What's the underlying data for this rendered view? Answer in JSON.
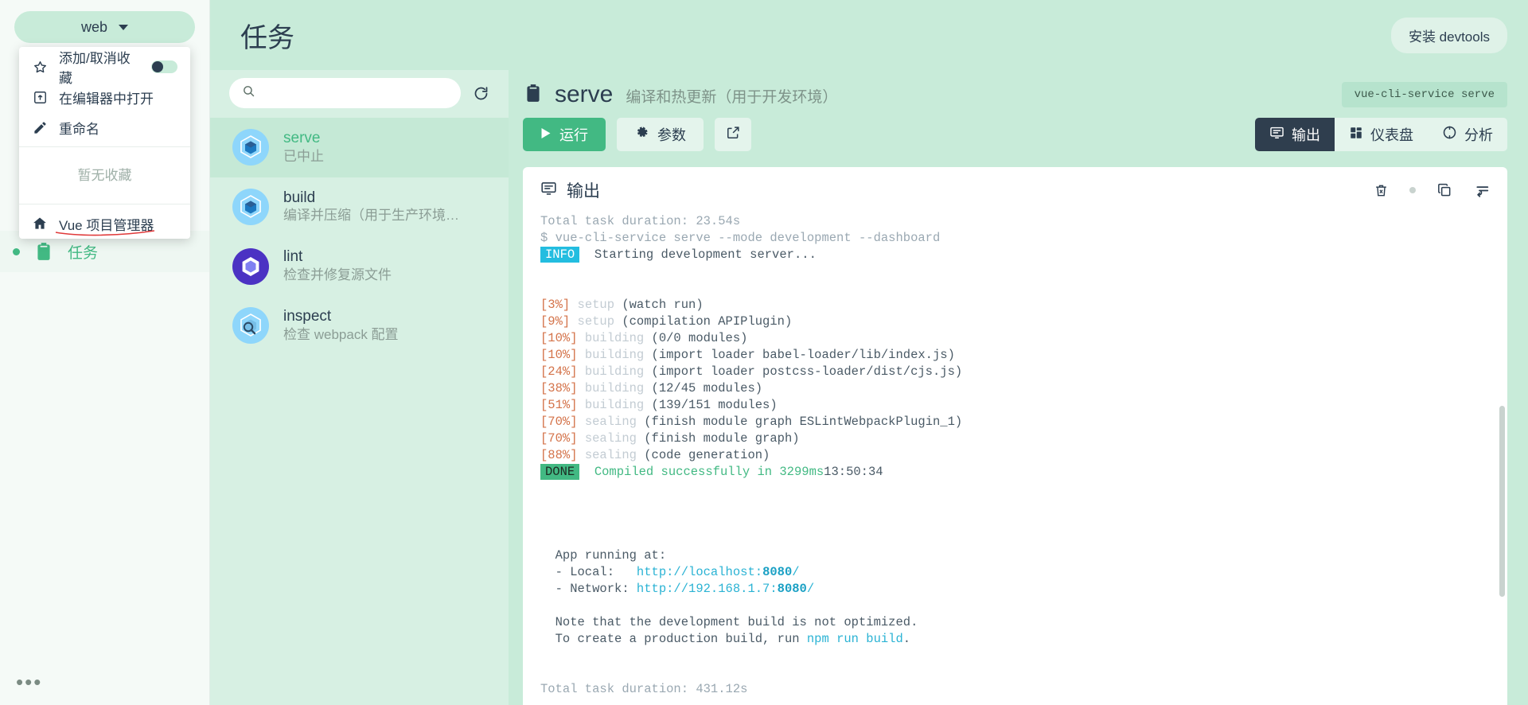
{
  "sidebar": {
    "project_switcher": {
      "label": "web",
      "icon": "chevron-down-icon"
    },
    "nav_items": [
      {
        "label": "",
        "icon": "dashboard-icon"
      },
      {
        "label": "",
        "icon": "plugins-icon"
      },
      {
        "label": "",
        "icon": "dependencies-icon"
      },
      {
        "label": "",
        "icon": "configuration-icon"
      },
      {
        "label": "任务",
        "icon": "tasks-icon",
        "active": true
      }
    ],
    "more_label": "•••",
    "dropdown": {
      "items": [
        {
          "label": "添加/取消收藏",
          "icon": "star-icon",
          "toggle": true
        },
        {
          "label": "在编辑器中打开",
          "icon": "open-in-editor-icon"
        },
        {
          "label": "重命名",
          "icon": "pencil-icon"
        }
      ],
      "empty_text": "暂无收藏",
      "home_item": {
        "label": "Vue 项目管理器",
        "icon": "home-icon"
      }
    }
  },
  "header": {
    "title": "任务",
    "devtools_button": "安装 devtools"
  },
  "tasklist": {
    "search": {
      "value": "",
      "placeholder": "",
      "icon": "search-icon"
    },
    "refresh_icon": "refresh-icon",
    "items": [
      {
        "name": "serve",
        "desc": "已中止",
        "icon": "webpack-icon",
        "selected": true
      },
      {
        "name": "build",
        "desc": "编译并压缩（用于生产环境…",
        "icon": "webpack-icon",
        "selected": false
      },
      {
        "name": "lint",
        "desc": "检查并修复源文件",
        "icon": "eslint-icon",
        "selected": false
      },
      {
        "name": "inspect",
        "desc": "检查 webpack 配置",
        "icon": "inspect-icon",
        "selected": false
      }
    ]
  },
  "detail": {
    "icon": "clipboard-icon",
    "name": "serve",
    "desc": "编译和热更新（用于开发环境）",
    "command_chip": "vue-cli-service serve",
    "buttons": {
      "run": {
        "label": "运行",
        "icon": "play-icon"
      },
      "params": {
        "label": "参数",
        "icon": "gear-icon"
      },
      "open_external": {
        "label": "",
        "icon": "external-link-icon"
      }
    },
    "tabs": [
      {
        "label": "输出",
        "icon": "terminal-icon",
        "active": true
      },
      {
        "label": "仪表盘",
        "icon": "dashboard-grid-icon",
        "active": false
      },
      {
        "label": "分析",
        "icon": "analyze-icon",
        "active": false
      }
    ]
  },
  "output": {
    "title": "输出",
    "title_icon": "terminal-icon",
    "actions": [
      {
        "icon": "trash-icon"
      },
      {
        "icon": "status-dot-icon"
      },
      {
        "icon": "copy-icon"
      },
      {
        "icon": "wrap-lines-icon"
      }
    ],
    "lines": [
      {
        "segs": [
          {
            "t": "Total task duration: 23.54s",
            "c": "muted"
          }
        ]
      },
      {
        "segs": [
          {
            "t": "$ vue-cli-service serve --mode development --dashboard",
            "c": "muted"
          }
        ]
      },
      {
        "segs": [
          {
            "t": "INFO",
            "c": "badge-info"
          },
          {
            "t": "  Starting development server...",
            "c": ""
          }
        ]
      },
      {
        "segs": [
          {
            "t": "",
            "c": ""
          }
        ]
      },
      {
        "segs": [
          {
            "t": "",
            "c": ""
          }
        ]
      },
      {
        "segs": [
          {
            "t": "[3%] ",
            "c": "pct"
          },
          {
            "t": "setup ",
            "c": "dim"
          },
          {
            "t": "(watch run)",
            "c": ""
          }
        ]
      },
      {
        "segs": [
          {
            "t": "[9%] ",
            "c": "pct"
          },
          {
            "t": "setup ",
            "c": "dim"
          },
          {
            "t": "(compilation APIPlugin)",
            "c": ""
          }
        ]
      },
      {
        "segs": [
          {
            "t": "[10%] ",
            "c": "pct"
          },
          {
            "t": "building ",
            "c": "dim"
          },
          {
            "t": "(0/0 modules)",
            "c": ""
          }
        ]
      },
      {
        "segs": [
          {
            "t": "[10%] ",
            "c": "pct"
          },
          {
            "t": "building ",
            "c": "dim"
          },
          {
            "t": "(import loader babel-loader/lib/index.js)",
            "c": ""
          }
        ]
      },
      {
        "segs": [
          {
            "t": "[24%] ",
            "c": "pct"
          },
          {
            "t": "building ",
            "c": "dim"
          },
          {
            "t": "(import loader postcss-loader/dist/cjs.js)",
            "c": ""
          }
        ]
      },
      {
        "segs": [
          {
            "t": "[38%] ",
            "c": "pct"
          },
          {
            "t": "building ",
            "c": "dim"
          },
          {
            "t": "(12/45 modules)",
            "c": ""
          }
        ]
      },
      {
        "segs": [
          {
            "t": "[51%] ",
            "c": "pct"
          },
          {
            "t": "building ",
            "c": "dim"
          },
          {
            "t": "(139/151 modules)",
            "c": ""
          }
        ]
      },
      {
        "segs": [
          {
            "t": "[70%] ",
            "c": "pct"
          },
          {
            "t": "sealing ",
            "c": "dim"
          },
          {
            "t": "(finish module graph ESLintWebpackPlugin_1)",
            "c": ""
          }
        ]
      },
      {
        "segs": [
          {
            "t": "[70%] ",
            "c": "pct"
          },
          {
            "t": "sealing ",
            "c": "dim"
          },
          {
            "t": "(finish module graph)",
            "c": ""
          }
        ]
      },
      {
        "segs": [
          {
            "t": "[88%] ",
            "c": "pct"
          },
          {
            "t": "sealing ",
            "c": "dim"
          },
          {
            "t": "(code generation)",
            "c": ""
          }
        ]
      },
      {
        "segs": [
          {
            "t": "DONE",
            "c": "badge-done"
          },
          {
            "t": "  Compiled successfully in 3299ms",
            "c": "green"
          },
          {
            "t": "13:50:34",
            "c": ""
          }
        ]
      },
      {
        "segs": [
          {
            "t": "",
            "c": ""
          }
        ]
      },
      {
        "segs": [
          {
            "t": "",
            "c": ""
          }
        ]
      },
      {
        "segs": [
          {
            "t": "",
            "c": ""
          }
        ]
      },
      {
        "segs": [
          {
            "t": "",
            "c": ""
          }
        ]
      },
      {
        "segs": [
          {
            "t": "  App running at:",
            "c": ""
          }
        ]
      },
      {
        "segs": [
          {
            "t": "  - Local:   ",
            "c": ""
          },
          {
            "t": "http://localhost:",
            "c": "cyan"
          },
          {
            "t": "8080",
            "c": "cyanb"
          },
          {
            "t": "/",
            "c": "cyan"
          }
        ]
      },
      {
        "segs": [
          {
            "t": "  - Network: ",
            "c": ""
          },
          {
            "t": "http://192.168.1.7:",
            "c": "cyan"
          },
          {
            "t": "8080",
            "c": "cyanb"
          },
          {
            "t": "/",
            "c": "cyan"
          }
        ]
      },
      {
        "segs": [
          {
            "t": "",
            "c": ""
          }
        ]
      },
      {
        "segs": [
          {
            "t": "  Note that the development build is not optimized.",
            "c": ""
          }
        ]
      },
      {
        "segs": [
          {
            "t": "  To create a production build, run ",
            "c": ""
          },
          {
            "t": "npm run build",
            "c": "cyan"
          },
          {
            "t": ".",
            "c": ""
          }
        ]
      },
      {
        "segs": [
          {
            "t": "",
            "c": ""
          }
        ]
      },
      {
        "segs": [
          {
            "t": "",
            "c": ""
          }
        ]
      },
      {
        "segs": [
          {
            "t": "Total task duration: 431.12s",
            "c": "muted"
          }
        ]
      }
    ]
  },
  "colors": {
    "accent": "#42b983",
    "bg_mint": "#c8ebd9",
    "panel_mint": "#d7f0e3",
    "dark": "#2f3e4e"
  }
}
